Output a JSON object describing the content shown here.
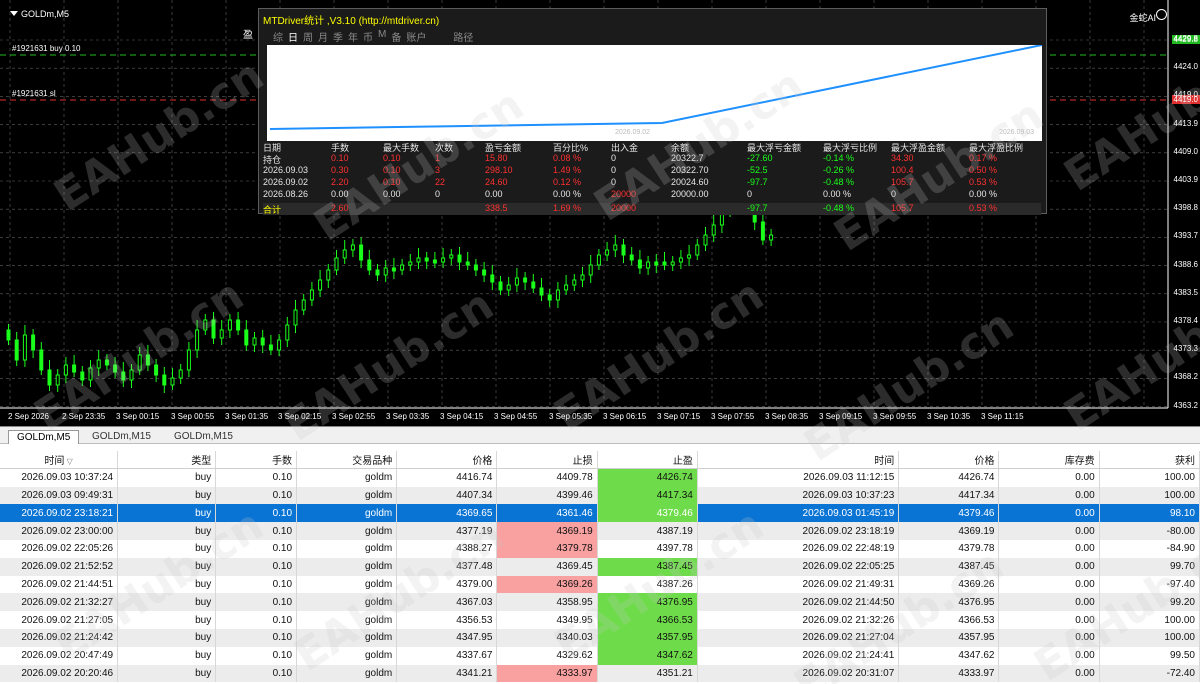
{
  "chart": {
    "symbol": "GOLDm,M5",
    "ea_label": "金蛇AI",
    "orders": [
      {
        "label": "#1921631 buy 0.10",
        "price": "4429.8",
        "color": "#22bb22"
      },
      {
        "label": "#1921631 sl",
        "price": "4419.0",
        "color": "#e03030"
      }
    ],
    "price_axis": [
      "4429.8",
      "4424.0",
      "4419.0",
      "4413.9",
      "4409.0",
      "4403.9",
      "4398.8",
      "4393.7",
      "4388.6",
      "4383.5",
      "4378.4",
      "4373.3",
      "4368.2",
      "4363.2"
    ],
    "time_axis": [
      "2 Sep 2026",
      "2 Sep 23:35",
      "3 Sep 00:15",
      "3 Sep 00:55",
      "3 Sep 01:35",
      "3 Sep 02:15",
      "3 Sep 02:55",
      "3 Sep 03:35",
      "3 Sep 04:15",
      "3 Sep 04:55",
      "3 Sep 05:35",
      "3 Sep 06:15",
      "3 Sep 07:15",
      "3 Sep 07:55",
      "3 Sep 08:35",
      "3 Sep 09:15",
      "3 Sep 09:55",
      "3 Sep 10:35",
      "3 Sep 11:15"
    ],
    "candle_color": "#19ff19"
  },
  "panel": {
    "title": "MTDriver统计 ,V3.10 (http://mtdriver.cn)",
    "close_char": "盈",
    "tabs": [
      "综",
      "日",
      "周",
      "月",
      "季",
      "年",
      "币",
      "M",
      "备",
      "账户",
      "路径"
    ],
    "active_tab": "日",
    "equity_dates": [
      "2026.09.02",
      "2026.09.03"
    ],
    "headers": [
      "日期",
      "手数",
      "最大手数",
      "次数",
      "盈亏金额",
      "百分比%",
      "出入金",
      "余额",
      "最大浮亏金额",
      "最大浮亏比例",
      "最大浮盈金额",
      "最大浮盈比例"
    ],
    "rows": [
      [
        "持仓",
        "0.10",
        "0.10",
        "1",
        "15.80",
        "0.08 %",
        "0",
        "20322.7",
        "-27.60",
        "-0.14 %",
        "34.30",
        "0.17 %"
      ],
      [
        "2026.09.03",
        "0.30",
        "0.10",
        "3",
        "298.10",
        "1.49 %",
        "0",
        "20322.70",
        "-52.5",
        "-0.26 %",
        "100.4",
        "0.50 %"
      ],
      [
        "2026.09.02",
        "2.20",
        "0.10",
        "22",
        "24.60",
        "0.12 %",
        "0",
        "20024.60",
        "-97.7",
        "-0.48 %",
        "105.7",
        "0.53 %"
      ],
      [
        "2026.08.26",
        "0.00",
        "0.00",
        "0",
        "0.00",
        "0.00 %",
        "20000",
        "20000.00",
        "0",
        "0.00 %",
        "0",
        "0.00 %"
      ]
    ],
    "total": [
      "合计",
      "2.60",
      "",
      "",
      "338.5",
      "1.69 %",
      "20000",
      "",
      "-97.7",
      "-0.48 %",
      "105.7",
      "0.53 %"
    ]
  },
  "terminal": {
    "tabs": [
      "GOLDm,M5",
      "GOLDm,M15",
      "GOLDm,M15"
    ],
    "columns": [
      "时间",
      "类型",
      "手数",
      "交易品种",
      "价格",
      "止损",
      "止盈",
      "时间",
      "价格",
      "库存费",
      "获利"
    ],
    "sort_icon": "▽",
    "rows": [
      {
        "open_time": "2026.09.03 10:37:24",
        "type": "buy",
        "lots": "0.10",
        "symbol": "goldm",
        "price": "4416.74",
        "sl": "4409.78",
        "tp": "4426.74",
        "close_time": "2026.09.03 11:12:15",
        "close_price": "4426.74",
        "swap": "0.00",
        "profit": "100.00",
        "hit": "tp"
      },
      {
        "open_time": "2026.09.03 09:49:31",
        "type": "buy",
        "lots": "0.10",
        "symbol": "goldm",
        "price": "4407.34",
        "sl": "4399.46",
        "tp": "4417.34",
        "close_time": "2026.09.03 10:37:23",
        "close_price": "4417.34",
        "swap": "0.00",
        "profit": "100.00",
        "hit": "tp"
      },
      {
        "open_time": "2026.09.02 23:18:21",
        "type": "buy",
        "lots": "0.10",
        "symbol": "goldm",
        "price": "4369.65",
        "sl": "4361.46",
        "tp": "4379.46",
        "close_time": "2026.09.03 01:45:19",
        "close_price": "4379.46",
        "swap": "0.00",
        "profit": "98.10",
        "hit": "tp",
        "selected": true
      },
      {
        "open_time": "2026.09.02 23:00:00",
        "type": "buy",
        "lots": "0.10",
        "symbol": "goldm",
        "price": "4377.19",
        "sl": "4369.19",
        "tp": "4387.19",
        "close_time": "2026.09.02 23:18:19",
        "close_price": "4369.19",
        "swap": "0.00",
        "profit": "-80.00",
        "hit": "sl"
      },
      {
        "open_time": "2026.09.02 22:05:26",
        "type": "buy",
        "lots": "0.10",
        "symbol": "goldm",
        "price": "4388.27",
        "sl": "4379.78",
        "tp": "4397.78",
        "close_time": "2026.09.02 22:48:19",
        "close_price": "4379.78",
        "swap": "0.00",
        "profit": "-84.90",
        "hit": "sl"
      },
      {
        "open_time": "2026.09.02 21:52:52",
        "type": "buy",
        "lots": "0.10",
        "symbol": "goldm",
        "price": "4377.48",
        "sl": "4369.45",
        "tp": "4387.45",
        "close_time": "2026.09.02 22:05:25",
        "close_price": "4387.45",
        "swap": "0.00",
        "profit": "99.70",
        "hit": "tp"
      },
      {
        "open_time": "2026.09.02 21:44:51",
        "type": "buy",
        "lots": "0.10",
        "symbol": "goldm",
        "price": "4379.00",
        "sl": "4369.26",
        "tp": "4387.26",
        "close_time": "2026.09.02 21:49:31",
        "close_price": "4369.26",
        "swap": "0.00",
        "profit": "-97.40",
        "hit": "sl"
      },
      {
        "open_time": "2026.09.02 21:32:27",
        "type": "buy",
        "lots": "0.10",
        "symbol": "goldm",
        "price": "4367.03",
        "sl": "4358.95",
        "tp": "4376.95",
        "close_time": "2026.09.02 21:44:50",
        "close_price": "4376.95",
        "swap": "0.00",
        "profit": "99.20",
        "hit": "tp"
      },
      {
        "open_time": "2026.09.02 21:27:05",
        "type": "buy",
        "lots": "0.10",
        "symbol": "goldm",
        "price": "4356.53",
        "sl": "4349.95",
        "tp": "4366.53",
        "close_time": "2026.09.02 21:32:26",
        "close_price": "4366.53",
        "swap": "0.00",
        "profit": "100.00",
        "hit": "tp"
      },
      {
        "open_time": "2026.09.02 21:24:42",
        "type": "buy",
        "lots": "0.10",
        "symbol": "goldm",
        "price": "4347.95",
        "sl": "4340.03",
        "tp": "4357.95",
        "close_time": "2026.09.02 21:27:04",
        "close_price": "4357.95",
        "swap": "0.00",
        "profit": "100.00",
        "hit": "tp"
      },
      {
        "open_time": "2026.09.02 20:47:49",
        "type": "buy",
        "lots": "0.10",
        "symbol": "goldm",
        "price": "4337.67",
        "sl": "4329.62",
        "tp": "4347.62",
        "close_time": "2026.09.02 21:24:41",
        "close_price": "4347.62",
        "swap": "0.00",
        "profit": "99.50",
        "hit": "tp"
      },
      {
        "open_time": "2026.09.02 20:20:46",
        "type": "buy",
        "lots": "0.10",
        "symbol": "goldm",
        "price": "4341.21",
        "sl": "4333.97",
        "tp": "4351.21",
        "close_time": "2026.09.02 20:31:07",
        "close_price": "4333.97",
        "swap": "0.00",
        "profit": "-72.40",
        "hit": "sl"
      }
    ]
  },
  "watermark": "EAHub.cn"
}
